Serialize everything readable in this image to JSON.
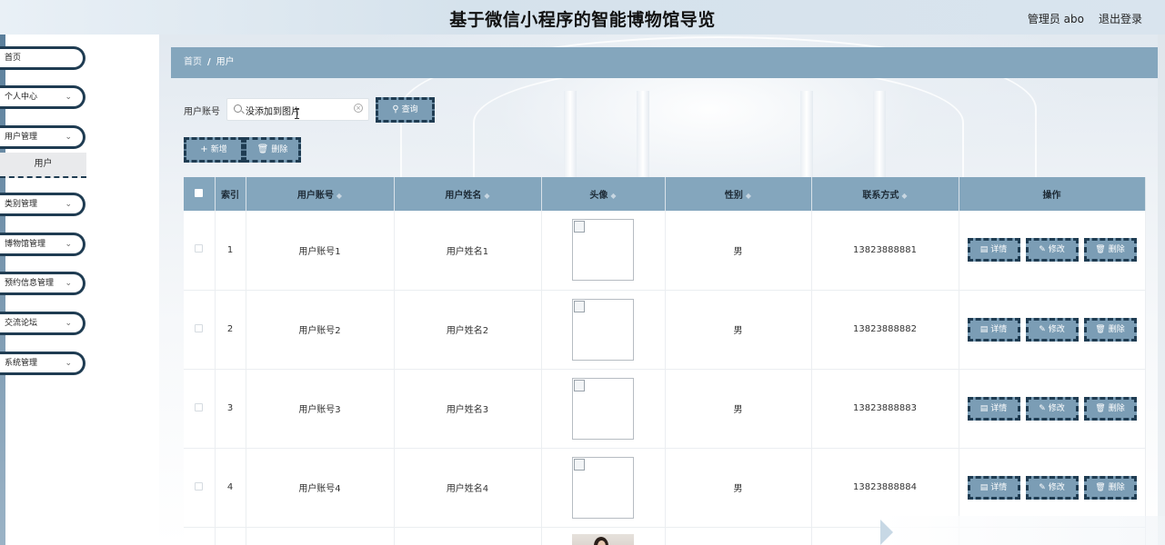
{
  "header": {
    "title": "基于微信小程序的智能博物馆导览",
    "user_label": "管理员 abo",
    "logout_label": "退出登录"
  },
  "sidebar": {
    "items": [
      {
        "label": "首页",
        "has_chevron": false
      },
      {
        "label": "个人中心",
        "has_chevron": true
      },
      {
        "label": "用户管理",
        "has_chevron": true
      },
      {
        "label": "类别管理",
        "has_chevron": true
      },
      {
        "label": "博物馆管理",
        "has_chevron": true
      },
      {
        "label": "预约信息管理",
        "has_chevron": true
      },
      {
        "label": "交流论坛",
        "has_chevron": true
      },
      {
        "label": "系统管理",
        "has_chevron": true
      }
    ],
    "active_submenu": "用户"
  },
  "breadcrumb": {
    "home": "首页",
    "separator": "/",
    "current": "用户"
  },
  "search": {
    "label": "用户账号",
    "value": "没添加到图片",
    "query_button": "查询"
  },
  "actions": {
    "add_label": "新增",
    "delete_label": "删除"
  },
  "table": {
    "columns": [
      "索引",
      "用户账号",
      "用户姓名",
      "头像",
      "性别",
      "联系方式",
      "操作"
    ],
    "rows": [
      {
        "index": "1",
        "account": "用户账号1",
        "name": "用户姓名1",
        "gender": "男",
        "phone": "13823888881"
      },
      {
        "index": "2",
        "account": "用户账号2",
        "name": "用户姓名2",
        "gender": "男",
        "phone": "13823888882"
      },
      {
        "index": "3",
        "account": "用户账号3",
        "name": "用户姓名3",
        "gender": "男",
        "phone": "13823888883"
      },
      {
        "index": "4",
        "account": "用户账号4",
        "name": "用户姓名4",
        "gender": "男",
        "phone": "13823888884"
      }
    ],
    "row_ops": {
      "detail": "详情",
      "edit": "修改",
      "delete": "删除"
    }
  },
  "colors": {
    "accent": "#84a6bd",
    "button_fill": "#7b9db5",
    "button_border": "#1f3c52"
  }
}
